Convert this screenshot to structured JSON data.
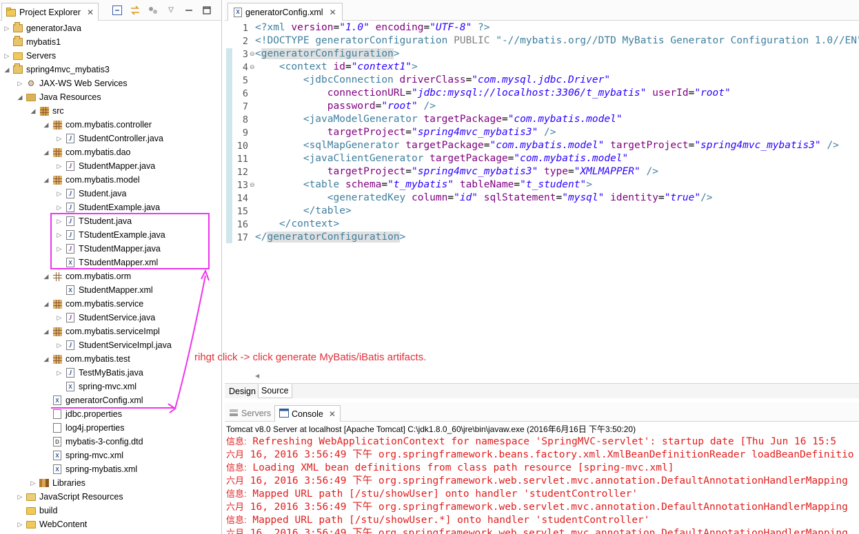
{
  "project_explorer": {
    "tab_title": "Project Explorer",
    "tree": [
      {
        "label": "generatorJava",
        "icon": "project-icon",
        "arrow": "▷"
      },
      {
        "label": "mybatis1",
        "icon": "project-icon",
        "arrow": ""
      },
      {
        "label": "Servers",
        "icon": "folder-icon",
        "arrow": "▷"
      },
      {
        "label": "spring4mvc_mybatis3",
        "icon": "project-icon",
        "arrow": "◢"
      },
      {
        "label": "JAX-WS Web Services",
        "icon": "webservice-icon",
        "arrow": "▷"
      },
      {
        "label": "Java Resources",
        "icon": "java-resources-icon",
        "arrow": "◢"
      },
      {
        "label": "src",
        "icon": "source-folder-icon",
        "arrow": "◢"
      },
      {
        "label": "com.mybatis.controller",
        "icon": "package-icon",
        "arrow": "◢"
      },
      {
        "label": "StudentController.java",
        "icon": "java-file-icon",
        "arrow": "▷"
      },
      {
        "label": "com.mybatis.dao",
        "icon": "package-icon",
        "arrow": "◢"
      },
      {
        "label": "StudentMapper.java",
        "icon": "java-interface-icon",
        "arrow": "▷"
      },
      {
        "label": "com.mybatis.model",
        "icon": "package-icon",
        "arrow": "◢"
      },
      {
        "label": "Student.java",
        "icon": "java-file-icon",
        "arrow": "▷"
      },
      {
        "label": "StudentExample.java",
        "icon": "java-file-icon",
        "arrow": "▷"
      },
      {
        "label": "TStudent.java",
        "icon": "java-file-icon",
        "arrow": "▷"
      },
      {
        "label": "TStudentExample.java",
        "icon": "java-file-icon",
        "arrow": "▷"
      },
      {
        "label": "TStudentMapper.java",
        "icon": "java-interface-icon",
        "arrow": "▷"
      },
      {
        "label": "TStudentMapper.xml",
        "icon": "xml-file-icon",
        "arrow": ""
      },
      {
        "label": "com.mybatis.orm",
        "icon": "package-empty-icon",
        "arrow": "◢"
      },
      {
        "label": "StudentMapper.xml",
        "icon": "xml-file-icon",
        "arrow": ""
      },
      {
        "label": "com.mybatis.service",
        "icon": "package-icon",
        "arrow": "◢"
      },
      {
        "label": "StudentService.java",
        "icon": "java-interface-icon",
        "arrow": "▷"
      },
      {
        "label": "com.mybatis.serviceImpl",
        "icon": "package-icon",
        "arrow": "◢"
      },
      {
        "label": "StudentServiceImpl.java",
        "icon": "java-file-icon",
        "arrow": "▷"
      },
      {
        "label": "com.mybatis.test",
        "icon": "package-icon",
        "arrow": "◢"
      },
      {
        "label": "TestMyBatis.java",
        "icon": "java-file-icon",
        "arrow": "▷"
      },
      {
        "label": "spring-mvc.xml",
        "icon": "xml-file-icon",
        "arrow": ""
      },
      {
        "label": "generatorConfig.xml",
        "icon": "xml-file-icon",
        "arrow": ""
      },
      {
        "label": "jdbc.properties",
        "icon": "properties-file-icon",
        "arrow": ""
      },
      {
        "label": "log4j.properties",
        "icon": "properties-file-icon",
        "arrow": ""
      },
      {
        "label": "mybatis-3-config.dtd",
        "icon": "dtd-file-icon",
        "arrow": ""
      },
      {
        "label": "spring-mvc.xml",
        "icon": "xml-file-icon",
        "arrow": ""
      },
      {
        "label": "spring-mybatis.xml",
        "icon": "xml-file-icon",
        "arrow": ""
      },
      {
        "label": "Libraries",
        "icon": "libraries-icon",
        "arrow": "▷"
      },
      {
        "label": "JavaScript Resources",
        "icon": "javascript-resources-icon",
        "arrow": "▷"
      },
      {
        "label": "build",
        "icon": "folder-icon",
        "arrow": ""
      },
      {
        "label": "WebContent",
        "icon": "folder-icon",
        "arrow": "▷"
      }
    ]
  },
  "editor": {
    "tab_title": "generatorConfig.xml",
    "line_numbers": [
      "1",
      "2",
      "3",
      "4",
      "5",
      "6",
      "7",
      "8",
      "9",
      "10",
      "11",
      "12",
      "13",
      "14",
      "15",
      "16",
      "17"
    ],
    "bottom_tabs": {
      "design": "Design",
      "source": "Source"
    },
    "code": {
      "l1": {
        "p1": "<?xml ",
        "a1": "version",
        "e1": "=",
        "s1": "\"1.0\"",
        "a2": " encoding",
        "e2": "=",
        "s2": "\"UTF-8\"",
        "p2": " ?>"
      },
      "l2": {
        "t1": "<!DOCTYPE ",
        "t2": "generatorConfiguration",
        "pub": " PUBLIC ",
        "s1": "\"-//mybatis.org//DTD MyBatis Generator Configuration 1.0//EN\""
      },
      "l3": {
        "t1": "<",
        "t2": "generatorConfiguration",
        "t3": ">"
      },
      "l4": {
        "indent": "    ",
        "t1": "<context ",
        "a1": "id",
        "e1": "=",
        "s1": "\"context1\"",
        "t2": ">"
      },
      "l5": {
        "indent": "        ",
        "t1": "<jdbcConnection ",
        "a1": "driverClass",
        "e1": "=",
        "s1": "\"com.mysql.jdbc.Driver\""
      },
      "l6": {
        "indent": "            ",
        "a1": "connectionURL",
        "e1": "=",
        "s1": "\"jdbc:mysql://localhost:3306/t_mybatis\"",
        "a2": " userId",
        "e2": "=",
        "s2": "\"root\""
      },
      "l7": {
        "indent": "            ",
        "a1": "password",
        "e1": "=",
        "s1": "\"root\"",
        "t1": " />"
      },
      "l8": {
        "indent": "        ",
        "t1": "<javaModelGenerator ",
        "a1": "targetPackage",
        "e1": "=",
        "s1": "\"com.mybatis.model\""
      },
      "l9": {
        "indent": "            ",
        "a1": "targetProject",
        "e1": "=",
        "s1": "\"spring4mvc_mybatis3\"",
        "t1": " />"
      },
      "l10": {
        "indent": "        ",
        "t1": "<sqlMapGenerator ",
        "a1": "targetPackage",
        "e1": "=",
        "s1": "\"com.mybatis.model\"",
        "a2": " targetProject",
        "e2": "=",
        "s2": "\"spring4mvc_mybatis3\"",
        "t2": " />"
      },
      "l11": {
        "indent": "        ",
        "t1": "<javaClientGenerator ",
        "a1": "targetPackage",
        "e1": "=",
        "s1": "\"com.mybatis.model\""
      },
      "l12": {
        "indent": "            ",
        "a1": "targetProject",
        "e1": "=",
        "s1": "\"spring4mvc_mybatis3\"",
        "a2": " type",
        "e2": "=",
        "s2": "\"XMLMAPPER\"",
        "t1": " />"
      },
      "l13": {
        "indent": "        ",
        "t1": "<table ",
        "a1": "schema",
        "e1": "=",
        "s1": "\"t_mybatis\"",
        "a2": " tableName",
        "e2": "=",
        "s2": "\"t_student\"",
        "t2": ">"
      },
      "l14": {
        "indent": "            ",
        "t1": "<generatedKey ",
        "a1": "column",
        "e1": "=",
        "s1": "\"id\"",
        "a2": " sqlStatement",
        "e2": "=",
        "s2": "\"mysql\"",
        "a3": " identity",
        "e3": "=",
        "s3": "\"true\"",
        "t2": "/>"
      },
      "l15": {
        "indent": "        ",
        "t1": "</table>"
      },
      "l16": {
        "indent": "    ",
        "t1": "</context>"
      },
      "l17": {
        "t1": "</",
        "t2": "generatorConfiguration",
        "t3": ">"
      }
    }
  },
  "annotation": {
    "text": "rihgt click -> click generate MyBatis/iBatis artifacts.",
    "color": "#e0303c",
    "highlight_color": "#ee33ee"
  },
  "console": {
    "tabs": {
      "servers": "Servers",
      "console": "Console"
    },
    "title": "Tomcat v8.0 Server at localhost [Apache Tomcat] C:\\jdk1.8.0_60\\jre\\bin\\javaw.exe (2016年6月16日 下午3:50:20)",
    "lines": [
      {
        "pre": "信息:",
        "text": " Refreshing WebApplicationContext for namespace 'SpringMVC-servlet': startup date [Thu Jun 16 15:5"
      },
      {
        "pre": "六月",
        "text": " 16, 2016 3:56:49 下午 org.springframework.beans.factory.xml.XmlBeanDefinitionReader loadBeanDefinitio"
      },
      {
        "pre": "信息:",
        "text": " Loading XML bean definitions from class path resource [spring-mvc.xml]"
      },
      {
        "pre": "六月",
        "text": " 16, 2016 3:56:49 下午 org.springframework.web.servlet.mvc.annotation.DefaultAnnotationHandlerMapping"
      },
      {
        "pre": "信息:",
        "text": " Mapped URL path [/stu/showUser] onto handler 'studentController'"
      },
      {
        "pre": "六月",
        "text": " 16, 2016 3:56:49 下午 org.springframework.web.servlet.mvc.annotation.DefaultAnnotationHandlerMapping"
      },
      {
        "pre": "信息:",
        "text": " Mapped URL path [/stu/showUser.*] onto handler 'studentController'"
      },
      {
        "pre": "六月",
        "text": " 16, 2016 3:56:49 下午 org.springframework.web.servlet.mvc.annotation.DefaultAnnotationHandlerMapping"
      }
    ],
    "text_color": "#e21d1d"
  }
}
